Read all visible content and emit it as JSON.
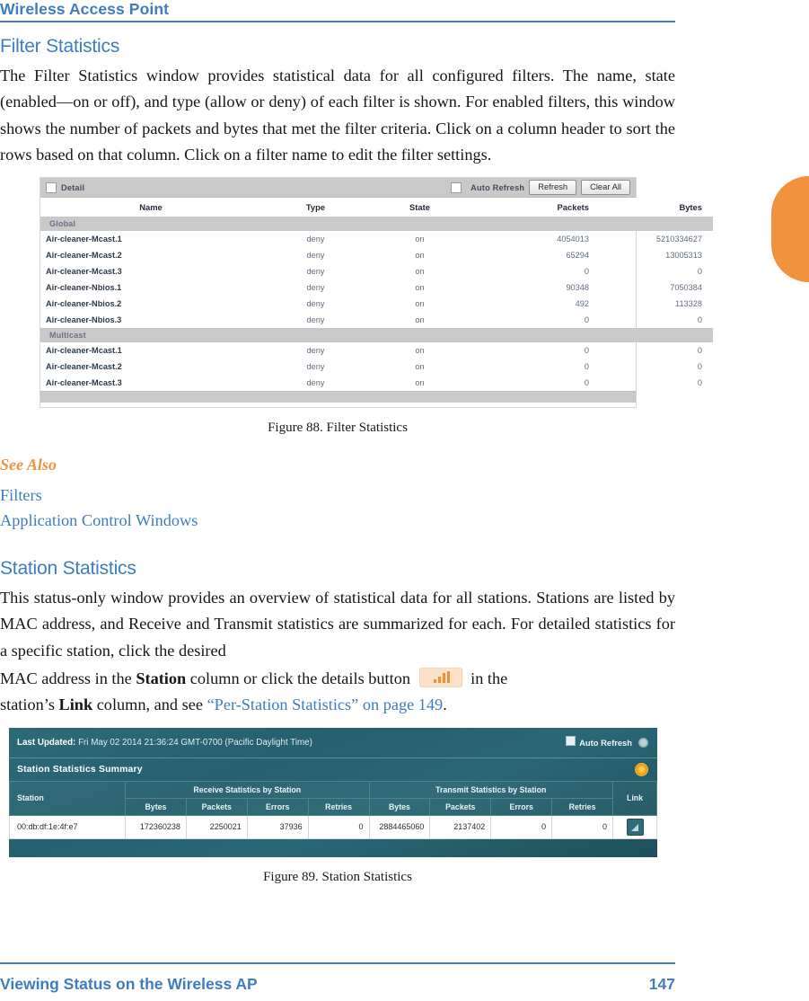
{
  "page": {
    "running_head": "Wireless Access Point",
    "footer_left": "Viewing Status on the Wireless AP",
    "footer_page_number": "147",
    "accent_blue": "#3f7cc0",
    "accent_orange": "#f2913d"
  },
  "filter_statistics": {
    "heading": "Filter Statistics",
    "paragraph": "The Filter Statistics window provides statistical data for all configured filters. The name, state (enabled—on or off), and type (allow or deny) of each filter is shown. For enabled filters, this window shows the number of packets and bytes that met the filter criteria. Click on a column header to sort the rows based on that column. Click on a filter name to edit the filter settings.",
    "figure_caption": "Figure 88. Filter Statistics"
  },
  "see_also": {
    "heading": "See Also",
    "links": [
      "Filters",
      "Application Control Windows"
    ]
  },
  "station_statistics": {
    "heading": "Station Statistics",
    "para_part1": "This status-only window provides an overview of statistical data for all stations. Stations are listed by MAC address, and Receive and Transmit statistics are summarized for each. For detailed statistics for a specific station, click the desired",
    "para_part2_a": "MAC address in the ",
    "para_part2_station": "Station",
    "para_part2_b": " column or click the details button",
    "para_part2_c": " in the",
    "para_part3_a": "station’s ",
    "para_part3_link": "Link",
    "para_part3_b": " column, and see ",
    "para_part3_xref": "“Per-Station Statistics” on page 149",
    "para_part3_c": ".",
    "figure_caption": "Figure 89. Station Statistics"
  },
  "figure88_screenshot": {
    "detail_checkbox_label": "Detail",
    "auto_refresh_label": "Auto Refresh",
    "refresh_button": "Refresh",
    "clear_all_button": "Clear All",
    "columns": [
      "Name",
      "Type",
      "State",
      "Packets",
      "Bytes"
    ],
    "groups": [
      {
        "group_label": "Global",
        "rows": [
          {
            "name": "Air-cleaner-Mcast.1",
            "type": "deny",
            "state": "on",
            "packets": "4054013",
            "bytes": "5210334627"
          },
          {
            "name": "Air-cleaner-Mcast.2",
            "type": "deny",
            "state": "on",
            "packets": "65294",
            "bytes": "13005313"
          },
          {
            "name": "Air-cleaner-Mcast.3",
            "type": "deny",
            "state": "on",
            "packets": "0",
            "bytes": "0"
          },
          {
            "name": "Air-cleaner-Nbios.1",
            "type": "deny",
            "state": "on",
            "packets": "90348",
            "bytes": "7050384"
          },
          {
            "name": "Air-cleaner-Nbios.2",
            "type": "deny",
            "state": "on",
            "packets": "492",
            "bytes": "113328"
          },
          {
            "name": "Air-cleaner-Nbios.3",
            "type": "deny",
            "state": "on",
            "packets": "0",
            "bytes": "0"
          }
        ]
      },
      {
        "group_label": "Multicast",
        "rows": [
          {
            "name": "Air-cleaner-Mcast.1",
            "type": "deny",
            "state": "on",
            "packets": "0",
            "bytes": "0"
          },
          {
            "name": "Air-cleaner-Mcast.2",
            "type": "deny",
            "state": "on",
            "packets": "0",
            "bytes": "0"
          },
          {
            "name": "Air-cleaner-Mcast.3",
            "type": "deny",
            "state": "on",
            "packets": "0",
            "bytes": "0"
          }
        ]
      }
    ]
  },
  "figure89_screenshot": {
    "last_updated_label": "Last Updated:",
    "last_updated_value": "Fri May 02 2014 21:36:24 GMT-0700 (Pacific Daylight Time)",
    "auto_refresh_label": "Auto Refresh",
    "summary_title": "Station Statistics Summary",
    "station_header": "Station",
    "receive_group_header": "Receive Statistics by Station",
    "transmit_group_header": "Transmit Statistics by Station",
    "link_header": "Link",
    "sub_headers": [
      "Bytes",
      "Packets",
      "Errors",
      "Retries"
    ],
    "rows": [
      {
        "station": "00:db:df:1e:4f:e7",
        "rx_bytes": "172360238",
        "rx_packets": "2250021",
        "rx_errors": "37936",
        "rx_retries": "0",
        "tx_bytes": "2884465060",
        "tx_packets": "2137402",
        "tx_errors": "0",
        "tx_retries": "0"
      }
    ]
  }
}
